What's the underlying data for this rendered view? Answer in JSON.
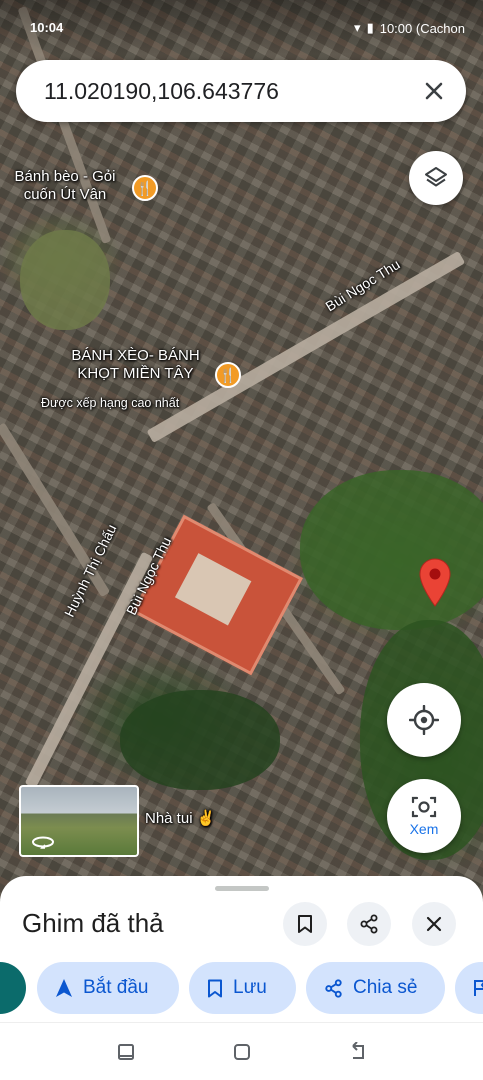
{
  "status_bar": {
    "time": "10:04",
    "right_text": "10:00 (Cachon"
  },
  "search": {
    "value": "11.020190,106.643776"
  },
  "map": {
    "labels": {
      "poi1_name": "Bánh bèo - Gỏi cuốn Út Vân",
      "poi1_line1": "Bánh bèo - Gỏi",
      "poi1_line2": "cuốn Út Vân",
      "poi2_line1": "BÁNH XÈO- BÁNH",
      "poi2_line2": "KHỌT MIỀN TÂY",
      "poi2_sub": "Được xếp hạng cao nhất",
      "street1": "Bùi Ngọc Thu",
      "street2": "Bùi Ngọc Thu",
      "street3": "Huỳnh Thị Chấu",
      "place_nha_tui": "Nhà tui ✌️"
    },
    "colors": {
      "pin": "#ea4335",
      "poi_food": "#f29b26"
    }
  },
  "buttons": {
    "xem_label": "Xem"
  },
  "sheet": {
    "title": "Ghim đã thả",
    "chips": {
      "start": "Bắt đầu",
      "save": "Lưu",
      "share": "Chia sẻ"
    }
  },
  "icons": [
    "layers-icon",
    "my-location-icon",
    "lens-camera-icon",
    "close-icon",
    "bookmark-icon",
    "share-icon",
    "navigation-arrow-icon",
    "drop-pin-icon",
    "food-icon"
  ],
  "accent": "#0b57d0"
}
